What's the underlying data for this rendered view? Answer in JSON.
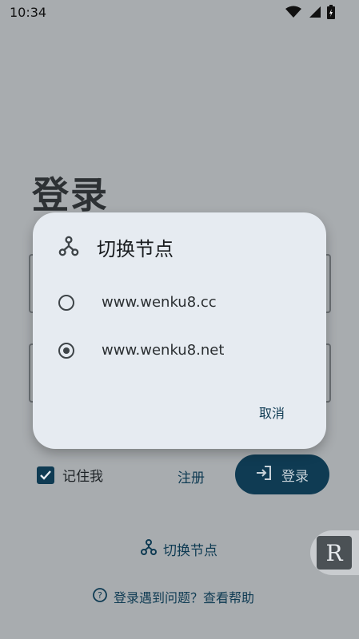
{
  "status_bar": {
    "time": "10:34",
    "icons": [
      "wifi-icon",
      "signal-icon",
      "battery-charging-icon"
    ]
  },
  "login_page": {
    "title": "登录",
    "remember_me": {
      "label": "记住我",
      "checked": true
    },
    "register_label": "注册",
    "login_button_label": "登录",
    "switch_node_label": "切换节点",
    "help_link_label": "登录遇到问题？查看帮助",
    "floating_badge_letter": "R"
  },
  "dialog": {
    "title": "切换节点",
    "options": [
      {
        "label": "www.wenku8.cc",
        "selected": false
      },
      {
        "label": "www.wenku8.net",
        "selected": true
      }
    ],
    "cancel_label": "取消"
  },
  "colors": {
    "scrim": "#a8acaf",
    "dialog_bg": "#e6ebf1",
    "accent": "#0f3b53"
  }
}
